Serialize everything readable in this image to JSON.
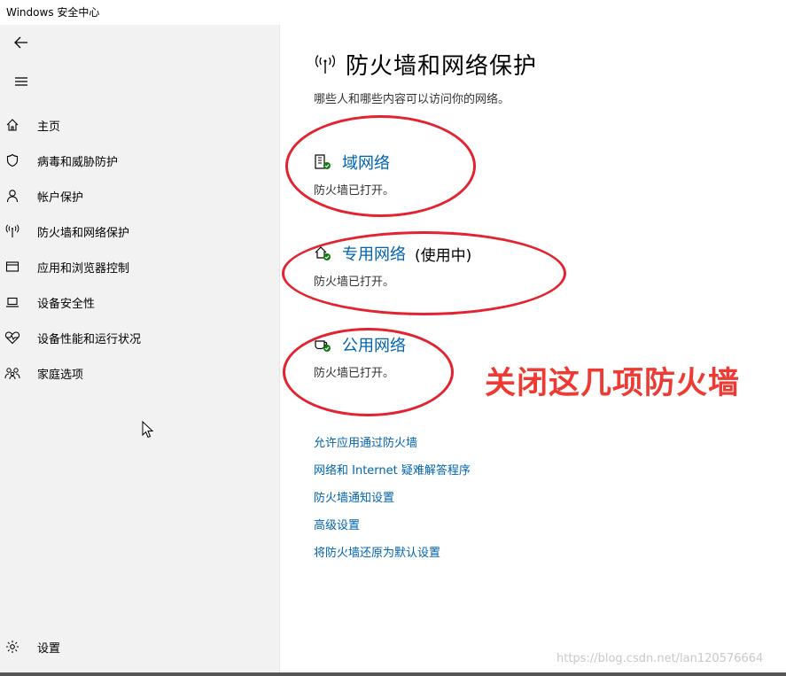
{
  "window": {
    "title": "Windows 安全中心"
  },
  "sidebar": {
    "items": [
      {
        "label": "主页",
        "icon": "home-icon"
      },
      {
        "label": "病毒和威胁防护",
        "icon": "shield-icon"
      },
      {
        "label": "帐户保护",
        "icon": "person-icon"
      },
      {
        "label": "防火墙和网络保护",
        "icon": "wifi-antenna-icon"
      },
      {
        "label": "应用和浏览器控制",
        "icon": "browser-window-icon"
      },
      {
        "label": "设备安全性",
        "icon": "laptop-icon"
      },
      {
        "label": "设备性能和运行状况",
        "icon": "heart-pulse-icon"
      },
      {
        "label": "家庭选项",
        "icon": "family-icon"
      }
    ],
    "settings_label": "设置"
  },
  "main": {
    "title": "防火墙和网络保护",
    "subtitle": "哪些人和哪些内容可以访问你的网络。",
    "networks": [
      {
        "name": "域网络",
        "status": "防火墙已打开。",
        "active": ""
      },
      {
        "name": "专用网络",
        "status": "防火墙已打开。",
        "active": "(使用中)"
      },
      {
        "name": "公用网络",
        "status": "防火墙已打开。",
        "active": ""
      }
    ],
    "links": [
      "允许应用通过防火墙",
      "网络和 Internet 疑难解答程序",
      "防火墙通知设置",
      "高级设置",
      "将防火墙还原为默认设置"
    ]
  },
  "annotation": {
    "text": "关闭这几项防火墙",
    "color": "#ee3a32"
  },
  "watermark": "https://blog.csdn.net/lan120576664",
  "colors": {
    "link": "#0063b1",
    "sidebar_bg": "#f2f2f2",
    "status_ok": "#107c10",
    "highlight_ring": "#e3232f"
  }
}
